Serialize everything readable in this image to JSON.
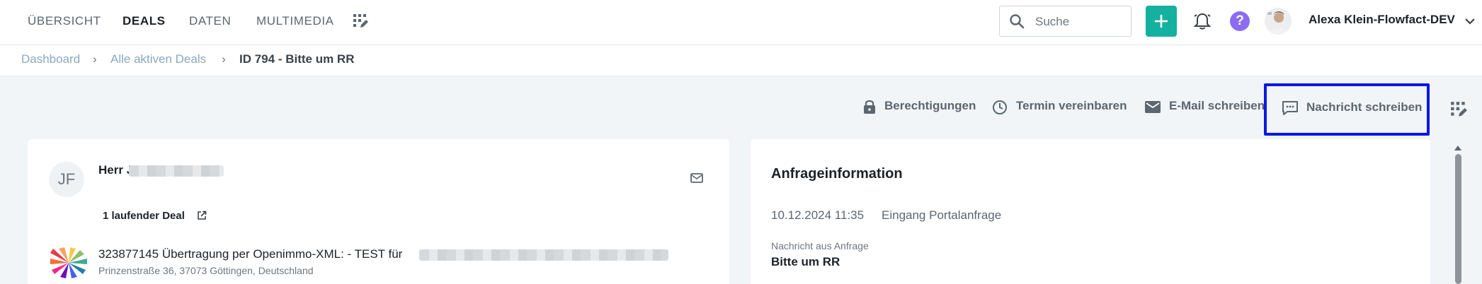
{
  "nav": {
    "items": [
      {
        "label": "ÜBERSICHT",
        "active": false
      },
      {
        "label": "DEALS",
        "active": true
      },
      {
        "label": "DATEN",
        "active": false
      },
      {
        "label": "MULTIMEDIA",
        "active": false
      }
    ],
    "grid_icon": "dashboard-grid-icon"
  },
  "header": {
    "search_placeholder": "Suche",
    "add_icon": "plus-icon",
    "notification_icon": "bell-icon",
    "help_label": "?",
    "user_name": "Alexa Klein-Flowfact-DEV",
    "accent_color": "#14b1a0",
    "help_color": "#8b6cf2"
  },
  "breadcrumb": {
    "items": [
      "Dashboard",
      "Alle aktiven Deals",
      "ID 794 - Bitte um RR"
    ],
    "separator": "›"
  },
  "actions": {
    "permissions": "Berechtigungen",
    "schedule": "Termin vereinbaren",
    "email": "E-Mail schreiben",
    "message": "Nachricht schreiben"
  },
  "contact": {
    "initials": "JF",
    "salutation": "Herr J",
    "running_deals": "1 laufender Deal",
    "deal_title": "323877145 Übertragung per Openimmo-XML: - TEST für",
    "deal_address": "Prinzenstraße 36, 37073 Göttingen, Deutschland"
  },
  "inquiry": {
    "title": "Anfrageinformation",
    "date": "10.12.2024 11:35",
    "event": "Eingang Portalanfrage",
    "message_label": "Nachricht aus Anfrage",
    "message_value": "Bitte um RR"
  },
  "highlight_color": "#0a17e8"
}
